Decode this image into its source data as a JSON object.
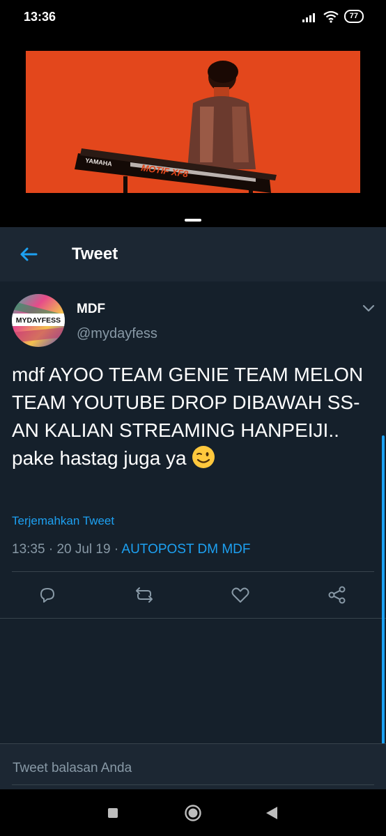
{
  "status_bar": {
    "time": "13:36",
    "battery": "77"
  },
  "media": {
    "overlay_text": "MOTIF XF8",
    "brand_text": "YAMAHA"
  },
  "app_bar": {
    "title": "Tweet"
  },
  "tweet": {
    "author_name": "MDF",
    "author_handle": "@mydayfess",
    "avatar_text": "MYDAYFESS",
    "text": "mdf AYOO TEAM GENIE TEAM MELON TEAM YOUTUBE DROP DIBAWAH SS-AN KALIAN STREAMING HANPEIJI.. pake hastag juga ya",
    "emoji_icon": "winking-face",
    "translate_link": "Terjemahkan Tweet",
    "time": "13:35",
    "separator": " · ",
    "date": "20 Jul 19",
    "source": "AUTOPOST DM MDF"
  },
  "reply": {
    "placeholder": "Tweet balasan Anda"
  },
  "colors": {
    "background": "#15202b",
    "accent": "#1da1f2",
    "media_orange": "#e3471c"
  }
}
